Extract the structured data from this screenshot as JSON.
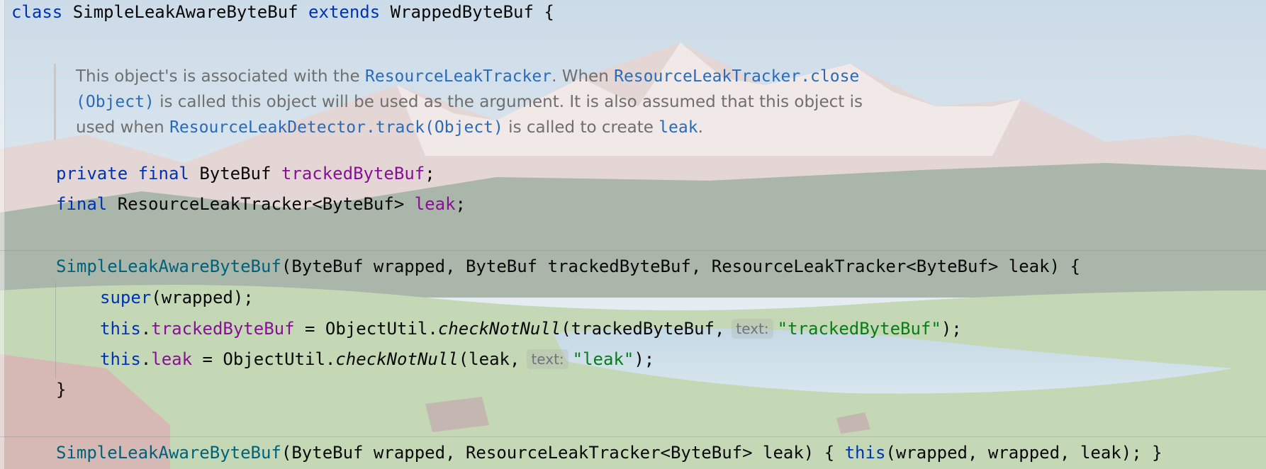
{
  "editor": {
    "class_decl": {
      "kw_class": "class",
      "name": "SimpleLeakAwareByteBuf",
      "kw_extends": "extends",
      "parent": "WrappedByteBuf",
      "brace": " {"
    },
    "doc": {
      "t1": "This object's is associated with the ",
      "r1": "ResourceLeakTracker",
      "t2": ". When ",
      "r2": "ResourceLeakTracker.close",
      "r3": "(Object)",
      "t3": " is called this object will be used as the argument. It is also assumed that this object is",
      "t4": "used when ",
      "r4": "ResourceLeakDetector.track(Object)",
      "t5": " is called to create ",
      "r5": "leak",
      "t6": "."
    },
    "field1": {
      "kw_private": "private",
      "kw_final": "final",
      "type": "ByteBuf",
      "name": "trackedByteBuf",
      "semi": ";"
    },
    "field2": {
      "kw_final": "final",
      "type": "ResourceLeakTracker<ByteBuf>",
      "name": "leak",
      "semi": ";"
    },
    "ctor1": {
      "name": "SimpleLeakAwareByteBuf",
      "params": "(ByteBuf wrapped, ByteBuf trackedByteBuf, ResourceLeakTracker<ByteBuf> leak) {",
      "kw_super": "super",
      "super_args": "(wrapped);",
      "line3": {
        "kw_this": "this",
        "dot": ".",
        "field": "trackedByteBuf",
        "assign": " = ObjectUtil.",
        "method": "checkNotNull",
        "args": "(trackedByteBuf,",
        "hint": "text:",
        "str": "\"trackedByteBuf\"",
        "end": ");"
      },
      "line4": {
        "kw_this": "this",
        "dot": ".",
        "field": "leak",
        "assign": " = ObjectUtil.",
        "method": "checkNotNull",
        "args": "(leak,",
        "hint": "text:",
        "str": "\"leak\"",
        "end": ");"
      },
      "close": "}"
    },
    "ctor2": {
      "name": "SimpleLeakAwareByteBuf",
      "params": "(ByteBuf wrapped, ResourceLeakTracker<ByteBuf> leak) { ",
      "kw_this": "this",
      "rest": "(wrapped, wrapped, leak); }"
    }
  }
}
